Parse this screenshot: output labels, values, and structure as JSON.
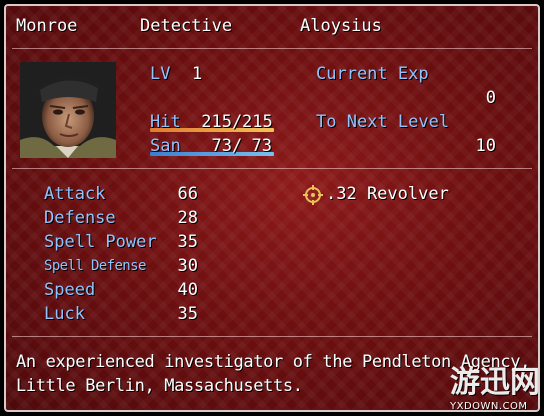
{
  "header": {
    "name": "Monroe",
    "class": "Detective",
    "nickname": "Aloysius"
  },
  "status": {
    "lv_label": "LV",
    "lv_value": "1",
    "hit_label": "Hit",
    "hit_current": "215",
    "hit_max": "215",
    "hit_fraction": 1.0,
    "san_label": "San",
    "san_current": "73",
    "san_max": "73",
    "san_fraction": 1.0,
    "current_exp_label": "Current Exp",
    "current_exp_value": "0",
    "next_level_label": "To Next Level",
    "next_level_value": "10"
  },
  "params": [
    {
      "label": "Attack",
      "value": "66"
    },
    {
      "label": "Defense",
      "value": "28"
    },
    {
      "label": "Spell Power",
      "value": "35"
    },
    {
      "label": "Spell Defense",
      "value": "30"
    },
    {
      "label": "Speed",
      "value": "40"
    },
    {
      "label": "Luck",
      "value": "35"
    }
  ],
  "equipment": {
    "icon": "crosshair-icon",
    "weapon": ".32 Revolver"
  },
  "description": {
    "line1": "An experienced investigator of the Pendleton Agency,",
    "line2": "Little Berlin, Massachusetts."
  },
  "watermark": {
    "cn": "游迅网",
    "en": "YXDOWN.COM"
  },
  "colors": {
    "hp_gauge_start": "#e07a2e",
    "hp_gauge_end": "#f2c15a",
    "san_gauge_start": "#3a7fd0",
    "san_gauge_end": "#79c0f0",
    "system_text": "#8fc4ff",
    "normal_text": "#ffffff"
  }
}
